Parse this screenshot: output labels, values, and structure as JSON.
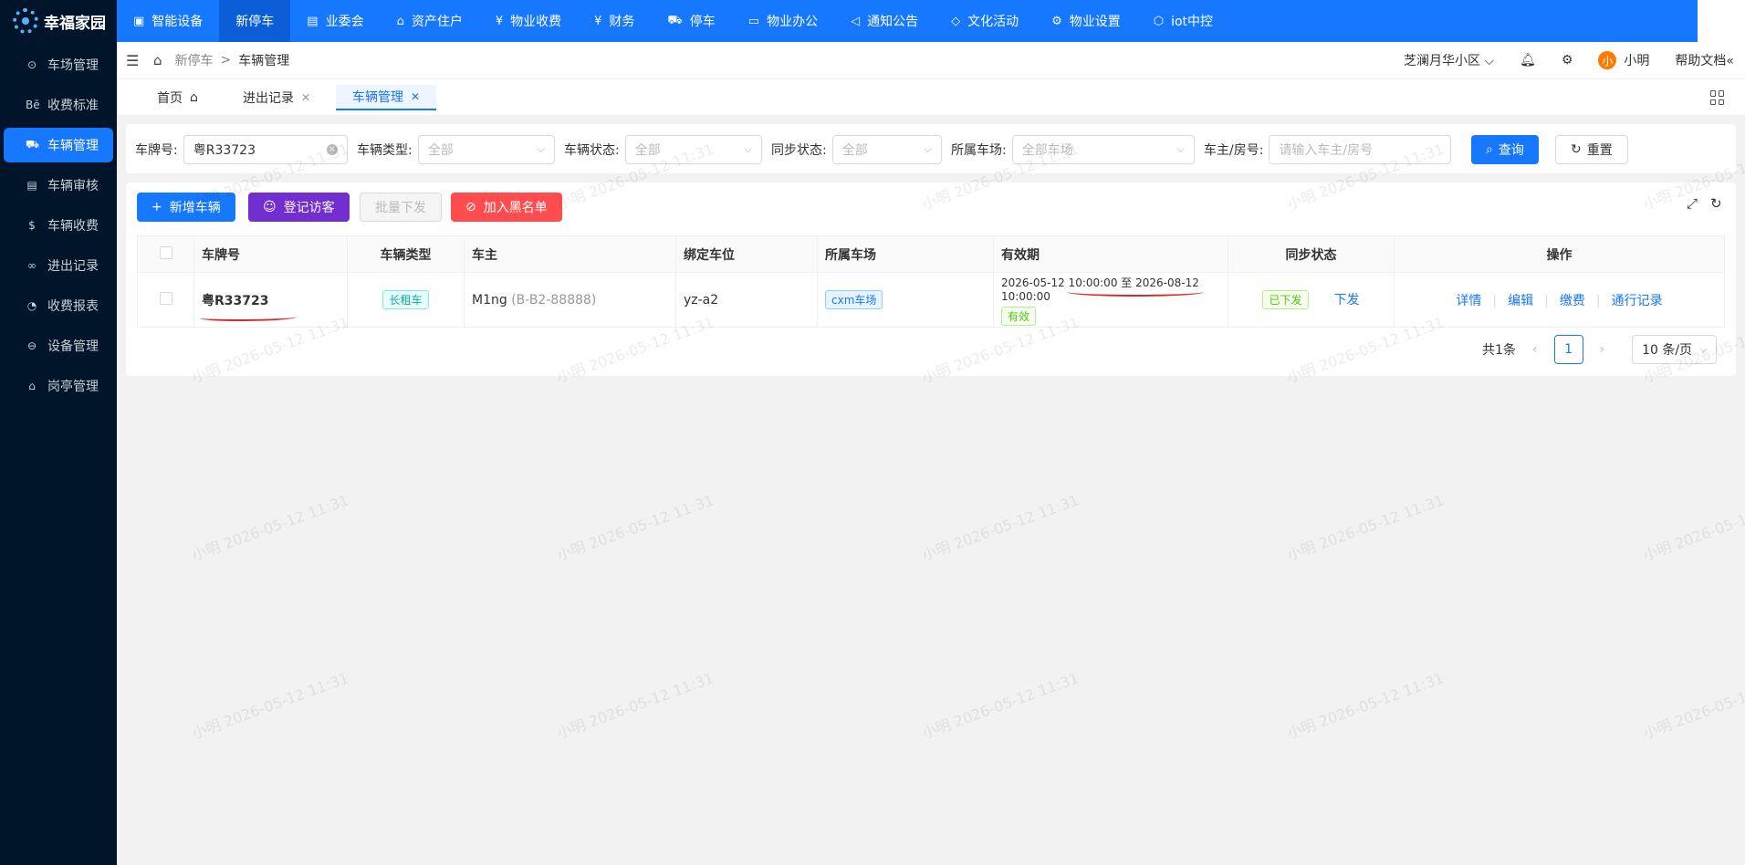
{
  "app": {
    "logo_text": "幸福家园"
  },
  "sidebar": {
    "items": [
      {
        "label": "车场管理",
        "icon": "parking-icon"
      },
      {
        "label": "收费标准",
        "icon": "behance-icon"
      },
      {
        "label": "车辆管理",
        "icon": "car-icon",
        "active": true
      },
      {
        "label": "车辆审核",
        "icon": "audit-icon"
      },
      {
        "label": "车辆收费",
        "icon": "coin-icon"
      },
      {
        "label": "进出记录",
        "icon": "link-icon"
      },
      {
        "label": "收费报表",
        "icon": "report-icon"
      },
      {
        "label": "设备管理",
        "icon": "device-icon"
      },
      {
        "label": "岗亭管理",
        "icon": "booth-icon"
      }
    ]
  },
  "topnav": {
    "items": [
      {
        "label": "智能设备",
        "icon": "device-icon"
      },
      {
        "label": "新停车",
        "active": true
      },
      {
        "label": "业委会",
        "icon": "committee-icon"
      },
      {
        "label": "资产住户",
        "icon": "home-icon"
      },
      {
        "label": "物业收费",
        "icon": "fee-icon"
      },
      {
        "label": "财务",
        "icon": "finance-icon"
      },
      {
        "label": "停车",
        "icon": "car-icon"
      },
      {
        "label": "物业办公",
        "icon": "laptop-icon"
      },
      {
        "label": "通知公告",
        "icon": "megaphone-icon"
      },
      {
        "label": "文化活动",
        "icon": "tag-icon"
      },
      {
        "label": "物业设置",
        "icon": "gear-icon"
      },
      {
        "label": "iot中控",
        "icon": "cube-icon"
      }
    ]
  },
  "header": {
    "breadcrumb": [
      "新停车",
      "车辆管理"
    ],
    "community": "芝澜月华小区",
    "avatar_text": "小",
    "user_name": "小明",
    "help_text": "帮助文档"
  },
  "tabs": [
    {
      "label": "首页"
    },
    {
      "label": "进出记录"
    },
    {
      "label": "车辆管理",
      "active": true
    }
  ],
  "search": {
    "plate_label": "车牌号:",
    "plate_value": "粤R33723",
    "type_label": "车辆类型:",
    "type_value": "全部",
    "status_label": "车辆状态:",
    "status_value": "全部",
    "sync_label": "同步状态:",
    "sync_value": "全部",
    "lot_label": "所属车场:",
    "lot_value": "全部车场",
    "owner_label": "车主/房号:",
    "owner_placeholder": "请输入车主/房号",
    "query_button": "查询",
    "reset_button": "重置"
  },
  "toolbar": {
    "add_vehicle": "新增车辆",
    "register_visitor": "登记访客",
    "batch_issue": "批量下发",
    "add_blacklist": "加入黑名单"
  },
  "table": {
    "columns": [
      "车牌号",
      "车辆类型",
      "车主",
      "绑定车位",
      "所属车场",
      "有效期",
      "同步状态",
      "操作"
    ],
    "rows": [
      {
        "plate": "粤R33723",
        "type": "长租车",
        "owner": "M1ng",
        "owner_room": "(B-B2-88888)",
        "space": "yz-a2",
        "lot": "cxm车场",
        "valid_start": "2026-05-12 10:00:00",
        "valid_sep": "至",
        "valid_end": "2026-08-12 10:00:00",
        "valid_status": "有效",
        "sync_status": "已下发",
        "sync_action": "下发",
        "ops": [
          "详情",
          "编辑",
          "缴费",
          "通行记录"
        ]
      }
    ]
  },
  "pagination": {
    "total_text": "共1条",
    "current_page": "1",
    "page_size": "10 条/页"
  },
  "watermark": "小明 2026-05-12 11:31",
  "colors": {
    "primary": "#1677ff",
    "sidebar_bg": "#001529",
    "visitor": "#722ed1",
    "danger": "#ff4d4f"
  }
}
